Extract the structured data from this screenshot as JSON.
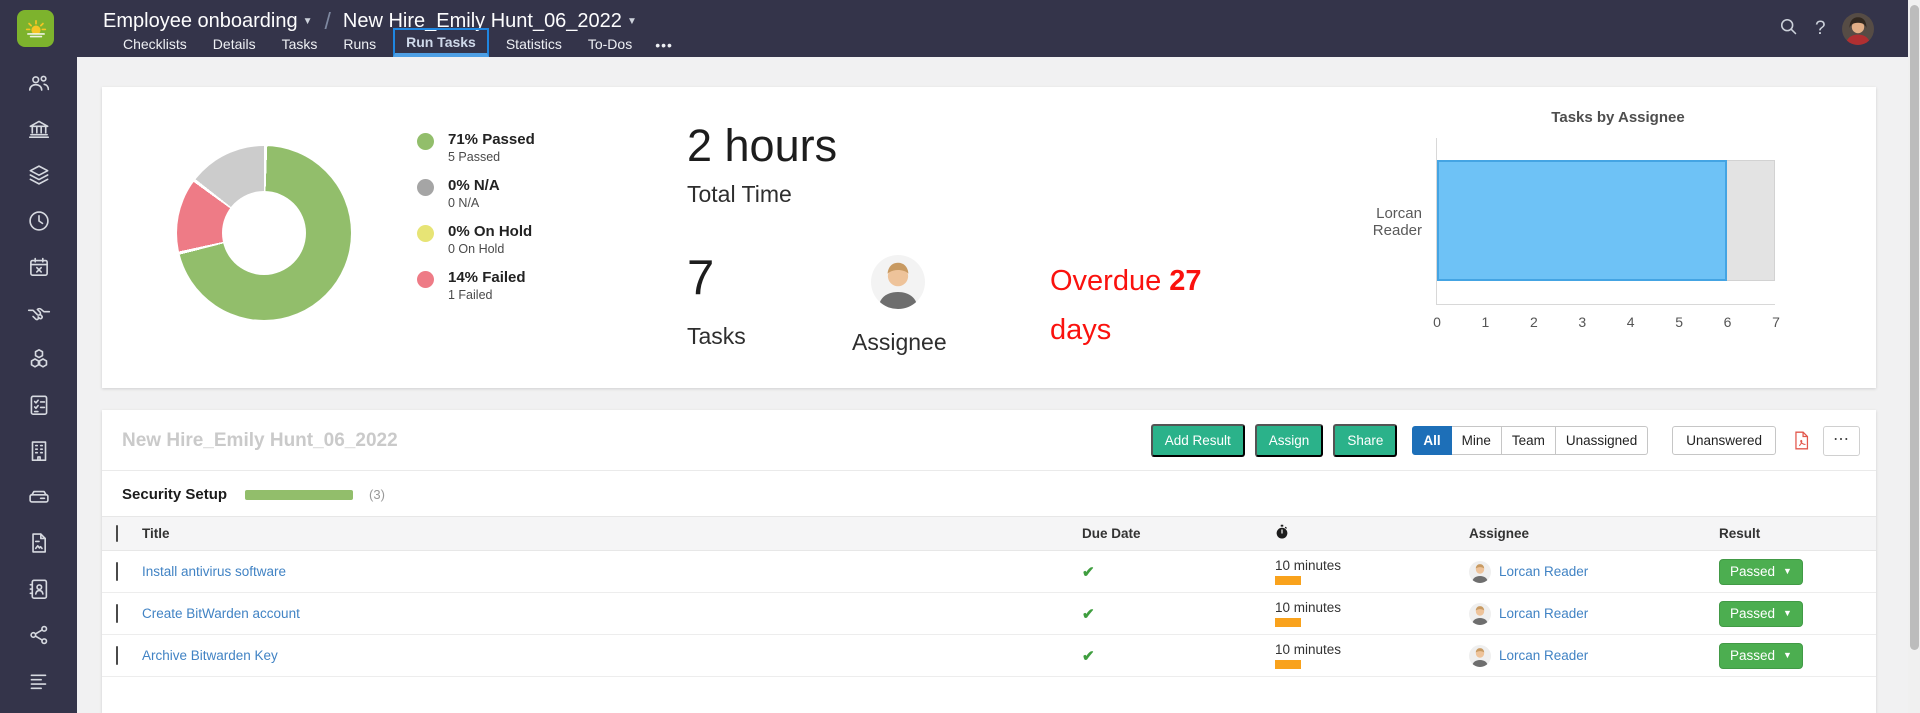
{
  "colors": {
    "chrome_navy": "#34344a",
    "logo_green": "#7db32d",
    "action_green": "#2bb28a",
    "filter_active_blue": "#1d6fb8",
    "link_blue": "#4183c4",
    "passed_green": "#4cae50",
    "overdue_red": "#fa120e",
    "duration_orange": "#f9a21c",
    "active_tab_border": "#1f86e0",
    "section_bar_green": "#92be6b"
  },
  "header": {
    "breadcrumb": {
      "parent": "Employee onboarding",
      "separator": "/",
      "current": "New Hire_Emily Hunt_06_2022"
    },
    "tabs": [
      {
        "label": "Checklists"
      },
      {
        "label": "Details"
      },
      {
        "label": "Tasks"
      },
      {
        "label": "Runs"
      },
      {
        "label": "Run Tasks",
        "active": true
      },
      {
        "label": "Statistics"
      },
      {
        "label": "To-Dos"
      }
    ],
    "tabs_overflow": "•••",
    "icons": {
      "search": "search-icon",
      "help_label": "?",
      "avatar": "user-avatar"
    }
  },
  "sidebar": {
    "icons": [
      "users",
      "bank",
      "layers",
      "clock",
      "calendar-x",
      "handshake",
      "cubes",
      "clipboard-list",
      "building",
      "server",
      "document",
      "address-book",
      "share-network",
      "text-lines"
    ]
  },
  "dashboard": {
    "legend": [
      {
        "pct": "71% Passed",
        "sub": "5 Passed",
        "color": "#92be6b"
      },
      {
        "pct": "0% N/A",
        "sub": "0 N/A",
        "color": "#a5a5a5"
      },
      {
        "pct": "0% On Hold",
        "sub": "0 On Hold",
        "color": "#e7e475"
      },
      {
        "pct": "14% Failed",
        "sub": "1 Failed",
        "color": "#ee7b86"
      }
    ],
    "total_time": {
      "value": "2 hours",
      "label": "Total Time"
    },
    "task_count": {
      "value": "7",
      "label": "Tasks"
    },
    "assignee_card": {
      "label": "Assignee"
    },
    "overdue": {
      "prefix": "Overdue",
      "value": "27",
      "line2": "days"
    }
  },
  "chart_data": [
    {
      "type": "pie",
      "subtype": "donut",
      "start": "top",
      "clockwise": true,
      "segments": [
        {
          "label": "Passed",
          "pct": 71,
          "color": "#92be6b"
        },
        {
          "label": "Failed",
          "pct": 14,
          "color": "#ee7b86"
        },
        {
          "label": "Remaining",
          "pct": 15,
          "color": "#cccccc"
        }
      ]
    },
    {
      "type": "bar",
      "orientation": "horizontal",
      "title": "Tasks by Assignee",
      "categories": [
        "Lorcan Reader"
      ],
      "values": [
        6
      ],
      "max": 7,
      "xticks": [
        0,
        1,
        2,
        3,
        4,
        5,
        6,
        7
      ],
      "bar_color": "#6ec2f6",
      "track_color": "#e3e3e3",
      "grid": false,
      "legend": "none"
    }
  ],
  "run": {
    "title": "New Hire_Emily Hunt_06_2022",
    "actions": [
      {
        "label": "Add Result"
      },
      {
        "label": "Assign"
      },
      {
        "label": "Share"
      }
    ],
    "filters": [
      {
        "label": "All",
        "active": true
      },
      {
        "label": "Mine"
      },
      {
        "label": "Team"
      },
      {
        "label": "Unassigned"
      }
    ],
    "unanswered_label": "Unanswered",
    "pdf_icon": "pdf-export-icon",
    "more_label": "⋯",
    "section": {
      "name": "Security Setup",
      "count": "(3)",
      "bar_color": "#92be6b"
    },
    "table": {
      "headers": {
        "title": "Title",
        "due": "Due Date",
        "time_icon": "stopwatch-icon",
        "assignee": "Assignee",
        "result": "Result"
      },
      "rows": [
        {
          "title": "Install antivirus software",
          "due_done": "✔",
          "time": "10 minutes",
          "assignee": "Lorcan Reader",
          "result": "Passed"
        },
        {
          "title": "Create BitWarden account",
          "due_done": "✔",
          "time": "10 minutes",
          "assignee": "Lorcan Reader",
          "result": "Passed"
        },
        {
          "title": "Archive Bitwarden Key",
          "due_done": "✔",
          "time": "10 minutes",
          "assignee": "Lorcan Reader",
          "result": "Passed"
        }
      ]
    }
  }
}
